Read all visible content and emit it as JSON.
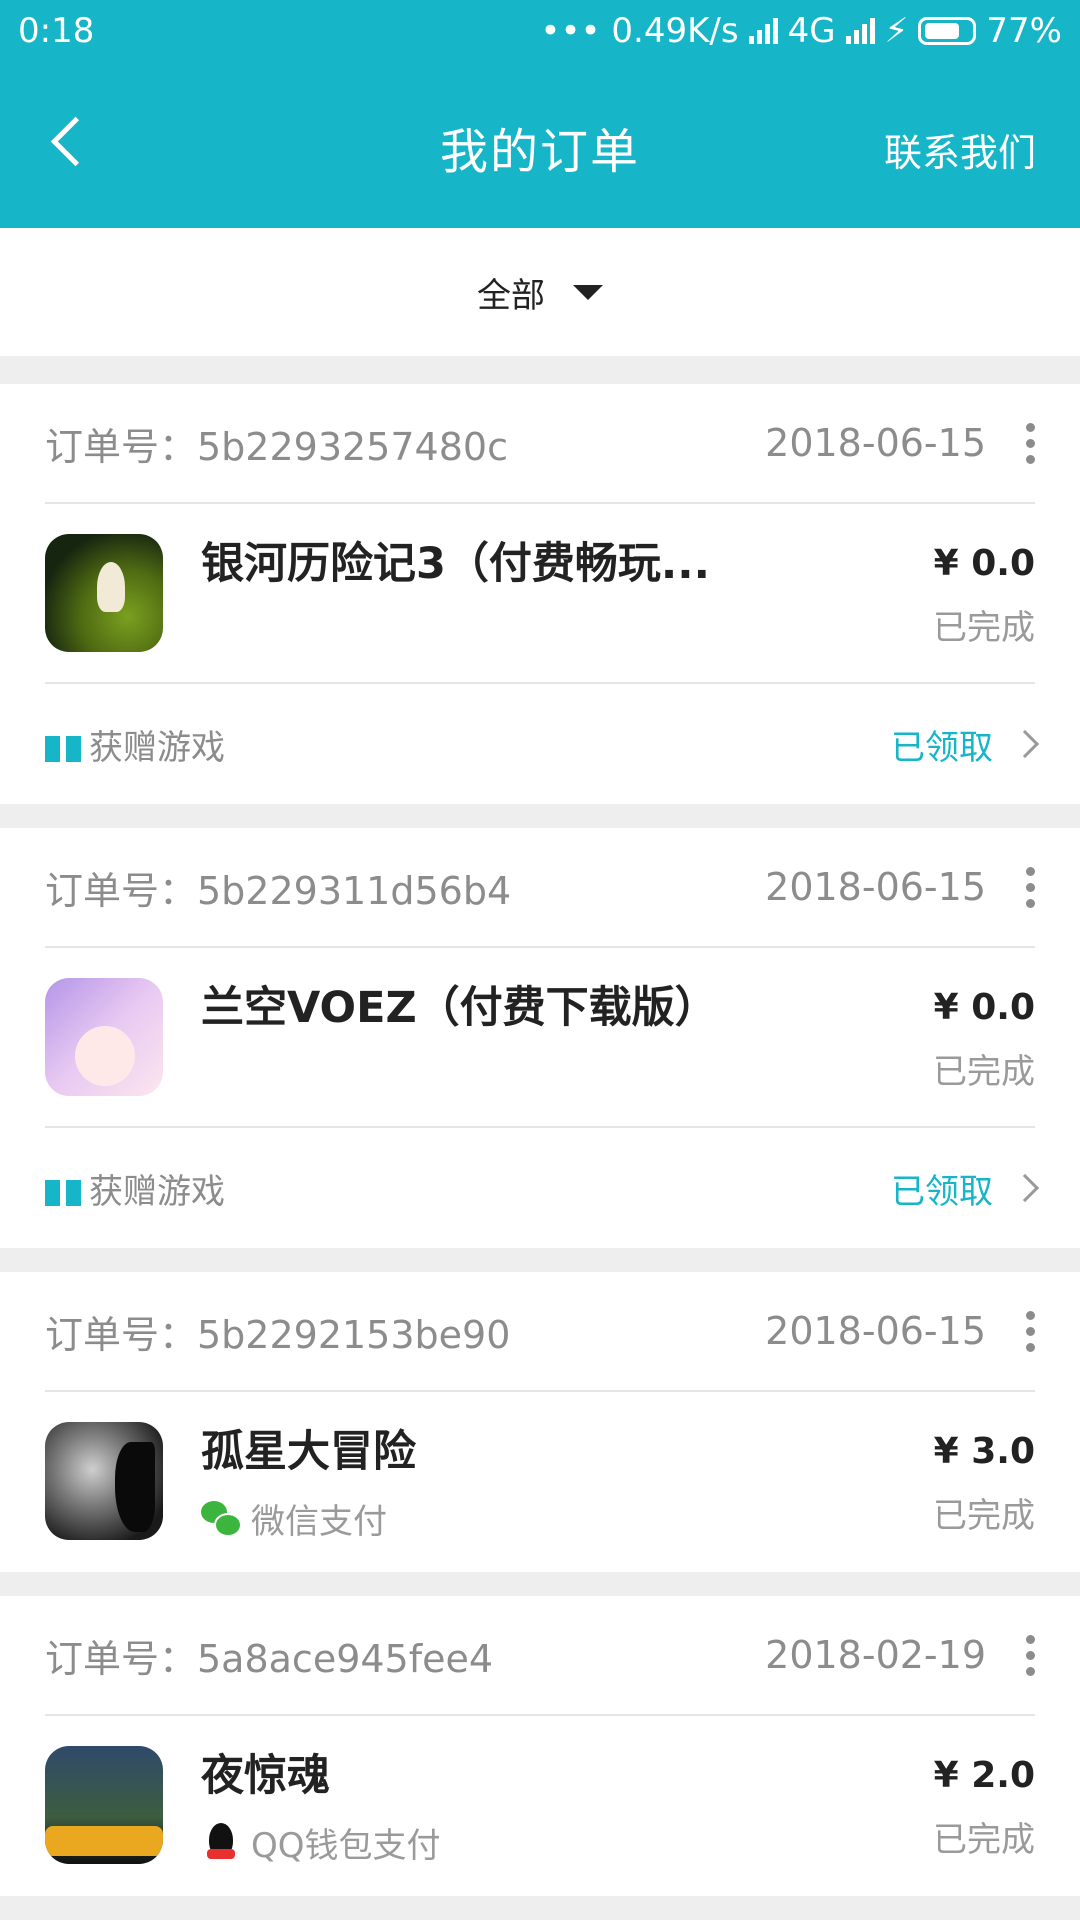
{
  "status_bar": {
    "time": "0:18",
    "speed": "••• 0.49K/s",
    "network": "4G",
    "battery": "77%"
  },
  "navbar": {
    "title": "我的订单",
    "action": "联系我们"
  },
  "filter": {
    "label": "全部"
  },
  "orders": [
    {
      "order_label": "订单号：5b2293257480c",
      "date": "2018-06-15",
      "title": "银河历险记3（付费畅玩...",
      "price": "¥ 0.0",
      "status": "已完成",
      "gift_label": "获赠游戏",
      "gift_status": "已领取"
    },
    {
      "order_label": "订单号：5b229311d56b4",
      "date": "2018-06-15",
      "title": "兰空VOEZ（付费下载版）",
      "price": "¥ 0.0",
      "status": "已完成",
      "gift_label": "获赠游戏",
      "gift_status": "已领取"
    },
    {
      "order_label": "订单号：5b2292153be90",
      "date": "2018-06-15",
      "title": "孤星大冒险",
      "payment": "微信支付",
      "price": "¥ 3.0",
      "status": "已完成"
    },
    {
      "order_label": "订单号：5a8ace945fee4",
      "date": "2018-02-19",
      "title": "夜惊魂",
      "payment": "QQ钱包支付",
      "price": "¥ 2.0",
      "status": "已完成"
    }
  ],
  "colors": {
    "accent": "#16b5c7",
    "background": "#eeeeee"
  }
}
